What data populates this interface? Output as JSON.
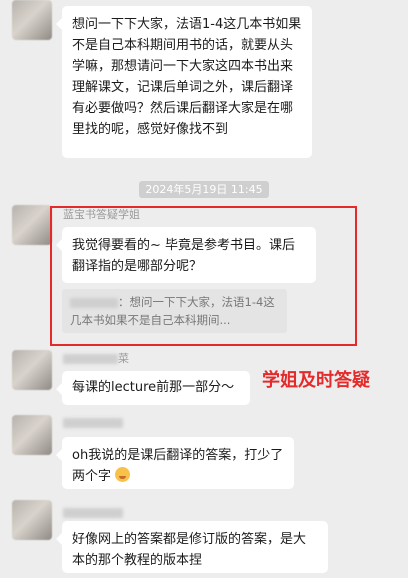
{
  "messages": [
    {
      "text": "想问一下下大家，法语1-4这几本书如果不是自己本科期间用书的话，就要从头学嘛，那想请问一下大家这四本书出来理解课文，记课后单词之外，课后翻译有必要做吗？然后课后翻译大家是在哪里找的呢，感觉好像找不到"
    },
    {
      "sender": "蓝宝书答疑学姐",
      "text": "我觉得要看的~ 毕竟是参考书目。课后翻译指的是哪部分呢？",
      "quote": "：想问一下下大家，法语1-4这几本书如果不是自己本科期间..."
    },
    {
      "sender_suffix": "菜",
      "text": "每课的lecture前那一部分～"
    },
    {
      "text": "oh我说的是课后翻译的答案，打少了两个字"
    },
    {
      "text": "好像网上的答案都是修订版的答案，是大本的那个教程的版本捏"
    }
  ],
  "timestamp": "2024年5月19日 11:45",
  "annotation": "学姐及时答疑",
  "colors": {
    "highlight": "#e42a2a",
    "background": "#ededed"
  }
}
